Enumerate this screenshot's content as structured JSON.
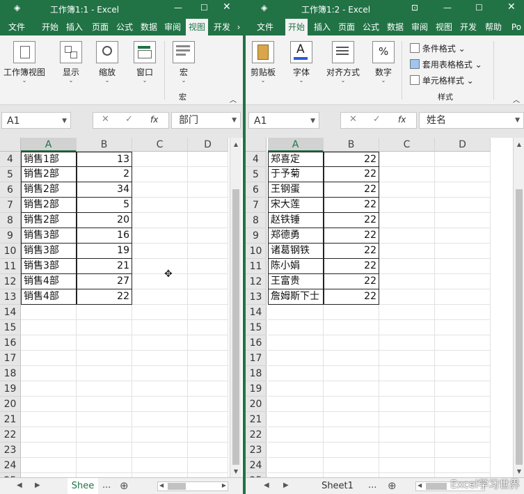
{
  "left": {
    "title": "工作簿1:1  -  Excel",
    "tabs": [
      "文件",
      "开始",
      "插入",
      "页面",
      "公式",
      "数据",
      "审阅",
      "视图",
      "开发"
    ],
    "active_tab": "视图",
    "ribbon": {
      "workbook_view": "工作簿视图",
      "show": "显示",
      "zoom": "缩放",
      "window": "窗口",
      "macro": "宏",
      "macro_group": "宏"
    },
    "namebox": "A1",
    "formula": "部门",
    "columns": [
      "A",
      "B",
      "C",
      "D"
    ],
    "rows": [
      {
        "n": "4",
        "a": "销售1部",
        "b": "13"
      },
      {
        "n": "5",
        "a": "销售2部",
        "b": "2"
      },
      {
        "n": "6",
        "a": "销售2部",
        "b": "34"
      },
      {
        "n": "7",
        "a": "销售2部",
        "b": "5"
      },
      {
        "n": "8",
        "a": "销售2部",
        "b": "20"
      },
      {
        "n": "9",
        "a": "销售3部",
        "b": "16"
      },
      {
        "n": "10",
        "a": "销售3部",
        "b": "19"
      },
      {
        "n": "11",
        "a": "销售3部",
        "b": "21"
      },
      {
        "n": "12",
        "a": "销售4部",
        "b": "27"
      },
      {
        "n": "13",
        "a": "销售4部",
        "b": "22"
      },
      {
        "n": "14",
        "a": "",
        "b": ""
      },
      {
        "n": "15",
        "a": "",
        "b": ""
      },
      {
        "n": "16",
        "a": "",
        "b": ""
      },
      {
        "n": "17",
        "a": "",
        "b": ""
      },
      {
        "n": "18",
        "a": "",
        "b": ""
      },
      {
        "n": "19",
        "a": "",
        "b": ""
      },
      {
        "n": "20",
        "a": "",
        "b": ""
      },
      {
        "n": "21",
        "a": "",
        "b": ""
      },
      {
        "n": "22",
        "a": "",
        "b": ""
      },
      {
        "n": "23",
        "a": "",
        "b": ""
      },
      {
        "n": "24",
        "a": "",
        "b": ""
      },
      {
        "n": "25",
        "a": "",
        "b": ""
      }
    ],
    "sheet_tab": "Shee",
    "ellipsis": "..."
  },
  "right": {
    "title": "工作簿1:2  -  Excel",
    "tabs": [
      "文件",
      "开始",
      "插入",
      "页面",
      "公式",
      "数据",
      "审阅",
      "视图",
      "开发",
      "帮助",
      "Po"
    ],
    "active_tab": "开始",
    "ribbon": {
      "clipboard": "剪贴板",
      "font": "字体",
      "align": "对齐方式",
      "number": "数字",
      "cond_format": "条件格式",
      "table_format": "套用表格格式",
      "cell_style": "单元格样式",
      "styles_group": "样式"
    },
    "namebox": "A1",
    "formula": "姓名",
    "columns": [
      "A",
      "B",
      "C",
      "D"
    ],
    "rows": [
      {
        "n": "4",
        "a": "郑喜定",
        "b": "22"
      },
      {
        "n": "5",
        "a": "于予菊",
        "b": "22"
      },
      {
        "n": "6",
        "a": "王钢蛋",
        "b": "22"
      },
      {
        "n": "7",
        "a": "宋大莲",
        "b": "22"
      },
      {
        "n": "8",
        "a": "赵铁锤",
        "b": "22"
      },
      {
        "n": "9",
        "a": "郑德勇",
        "b": "22"
      },
      {
        "n": "10",
        "a": "诸葛钢铁",
        "b": "22"
      },
      {
        "n": "11",
        "a": "陈小娟",
        "b": "22"
      },
      {
        "n": "12",
        "a": "王富贵",
        "b": "22"
      },
      {
        "n": "13",
        "a": "詹姆斯下士",
        "b": "22"
      },
      {
        "n": "14",
        "a": "",
        "b": ""
      },
      {
        "n": "15",
        "a": "",
        "b": ""
      },
      {
        "n": "16",
        "a": "",
        "b": ""
      },
      {
        "n": "17",
        "a": "",
        "b": ""
      },
      {
        "n": "18",
        "a": "",
        "b": ""
      },
      {
        "n": "19",
        "a": "",
        "b": ""
      },
      {
        "n": "20",
        "a": "",
        "b": ""
      },
      {
        "n": "21",
        "a": "",
        "b": ""
      },
      {
        "n": "22",
        "a": "",
        "b": ""
      },
      {
        "n": "23",
        "a": "",
        "b": ""
      },
      {
        "n": "24",
        "a": "",
        "b": ""
      },
      {
        "n": "25",
        "a": "",
        "b": ""
      }
    ],
    "sheet_tab": "Sheet1",
    "ellipsis": "..."
  },
  "watermark": "Excel学习世界",
  "icons": {
    "minimize": "minimize-icon",
    "maximize": "maximize-icon",
    "close": "close-icon",
    "function": "fx-icon",
    "cancel": "cancel-icon",
    "confirm": "check-icon",
    "add_sheet": "plus-icon"
  },
  "colors": {
    "accent": "#217346"
  }
}
